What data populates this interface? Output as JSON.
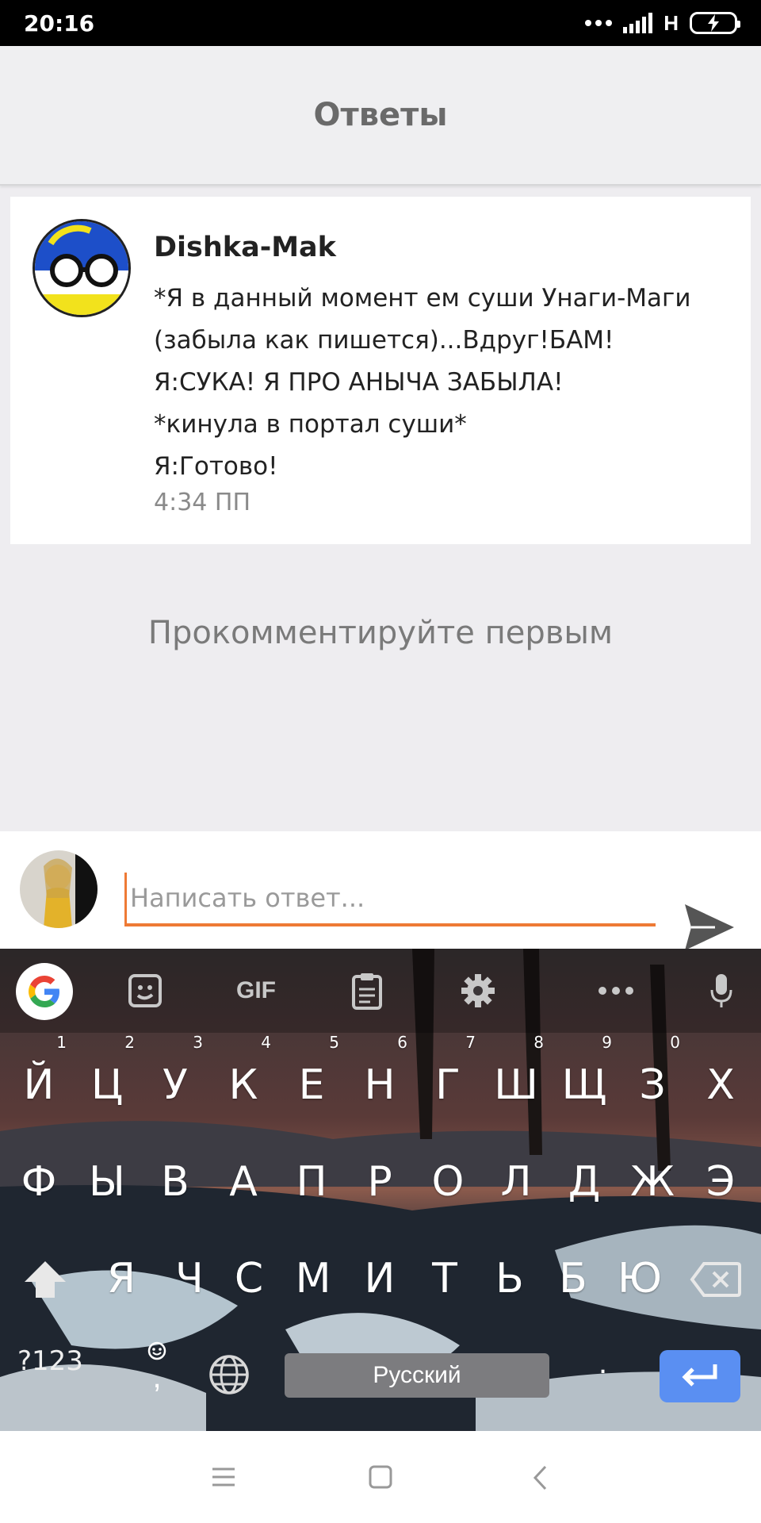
{
  "status_bar": {
    "time": "20:16",
    "network": "H"
  },
  "header": {
    "title": "Ответы"
  },
  "comment": {
    "author": "Dishka-Mak",
    "lines": [
      "*Я в данный момент ем суши Унаги-Маги",
      "(забыла как пишется)...Вдруг!БАМ!",
      "Я:СУКА! Я ПРО АНЫЧА ЗАБЫЛА!",
      "*кинула в портал суши*",
      "Я:Готово!"
    ],
    "time": "4:34 ПП"
  },
  "empty_state": "Прокомментируйте первым",
  "reply": {
    "placeholder": "Написать ответ...",
    "accent": "#ee7a35"
  },
  "keyboard": {
    "toolbar": [
      "google-icon",
      "sticker-icon",
      "GIF",
      "clipboard-icon",
      "settings-icon",
      "more-icon",
      "mic-icon"
    ],
    "row1": [
      "Й",
      "Ц",
      "У",
      "К",
      "Е",
      "Н",
      "Г",
      "Ш",
      "Щ",
      "З",
      "Х"
    ],
    "row1_hints": [
      "1",
      "2",
      "3",
      "4",
      "5",
      "6",
      "7",
      "8",
      "9",
      "0",
      ""
    ],
    "row2": [
      "Ф",
      "Ы",
      "В",
      "А",
      "П",
      "Р",
      "О",
      "Л",
      "Д",
      "Ж",
      "Э"
    ],
    "row3": [
      "Я",
      "Ч",
      "С",
      "М",
      "И",
      "Т",
      "Ь",
      "Б",
      "Ю"
    ],
    "numbers_key": "?123",
    "space_label": "Русский",
    "period": ".",
    "emoji_comma": ",",
    "enter_color": "#5a8ff2"
  },
  "nav": [
    "menu-icon",
    "home-icon",
    "back-icon"
  ]
}
